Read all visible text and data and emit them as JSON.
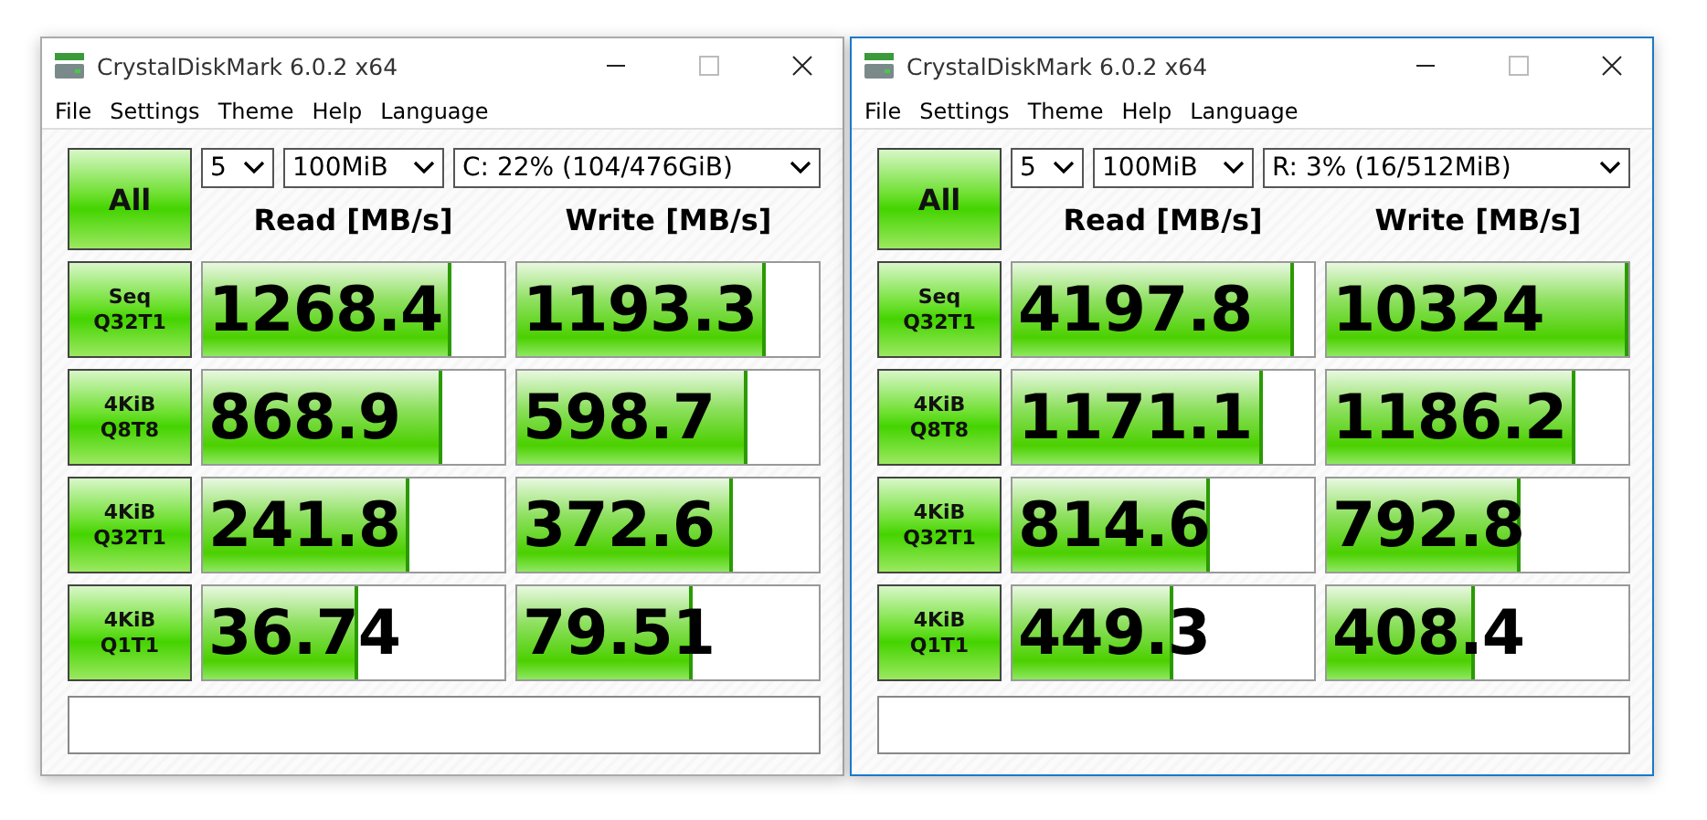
{
  "windows": [
    {
      "title": "CrystalDiskMark 6.0.2 x64",
      "active": false,
      "menu": [
        "File",
        "Settings",
        "Theme",
        "Help",
        "Language"
      ],
      "all_button": "All",
      "count": "5",
      "size": "100MiB",
      "drive": "C: 22% (104/476GiB)",
      "headers": [
        "Read [MB/s]",
        "Write [MB/s]"
      ],
      "tests": [
        {
          "label_1": "Seq",
          "label_2": "Q32T1",
          "read": {
            "value": "1268.4",
            "level": 0.81
          },
          "write": {
            "value": "1193.3",
            "level": 0.81
          }
        },
        {
          "label_1": "4KiB",
          "label_2": "Q8T8",
          "read": {
            "value": "868.9",
            "level": 0.78
          },
          "write": {
            "value": "598.7",
            "level": 0.75
          }
        },
        {
          "label_1": "4KiB",
          "label_2": "Q32T1",
          "read": {
            "value": "241.8",
            "level": 0.67
          },
          "write": {
            "value": "372.6",
            "level": 0.7
          }
        },
        {
          "label_1": "4KiB",
          "label_2": "Q1T1",
          "read": {
            "value": "36.74",
            "level": 0.5
          },
          "write": {
            "value": "79.51",
            "level": 0.57
          }
        }
      ]
    },
    {
      "title": "CrystalDiskMark 6.0.2 x64",
      "active": true,
      "menu": [
        "File",
        "Settings",
        "Theme",
        "Help",
        "Language"
      ],
      "all_button": "All",
      "count": "5",
      "size": "100MiB",
      "drive": "R: 3% (16/512MiB)",
      "headers": [
        "Read [MB/s]",
        "Write [MB/s]"
      ],
      "tests": [
        {
          "label_1": "Seq",
          "label_2": "Q32T1",
          "read": {
            "value": "4197.8",
            "level": 0.92
          },
          "write": {
            "value": "10324",
            "level": 0.99
          }
        },
        {
          "label_1": "4KiB",
          "label_2": "Q8T8",
          "read": {
            "value": "1171.1",
            "level": 0.82
          },
          "write": {
            "value": "1186.2",
            "level": 0.81
          }
        },
        {
          "label_1": "4KiB",
          "label_2": "Q32T1",
          "read": {
            "value": "814.6",
            "level": 0.64
          },
          "write": {
            "value": "792.8",
            "level": 0.63
          }
        },
        {
          "label_1": "4KiB",
          "label_2": "Q1T1",
          "read": {
            "value": "449.3",
            "level": 0.52
          },
          "write": {
            "value": "408.4",
            "level": 0.48
          }
        }
      ]
    }
  ]
}
